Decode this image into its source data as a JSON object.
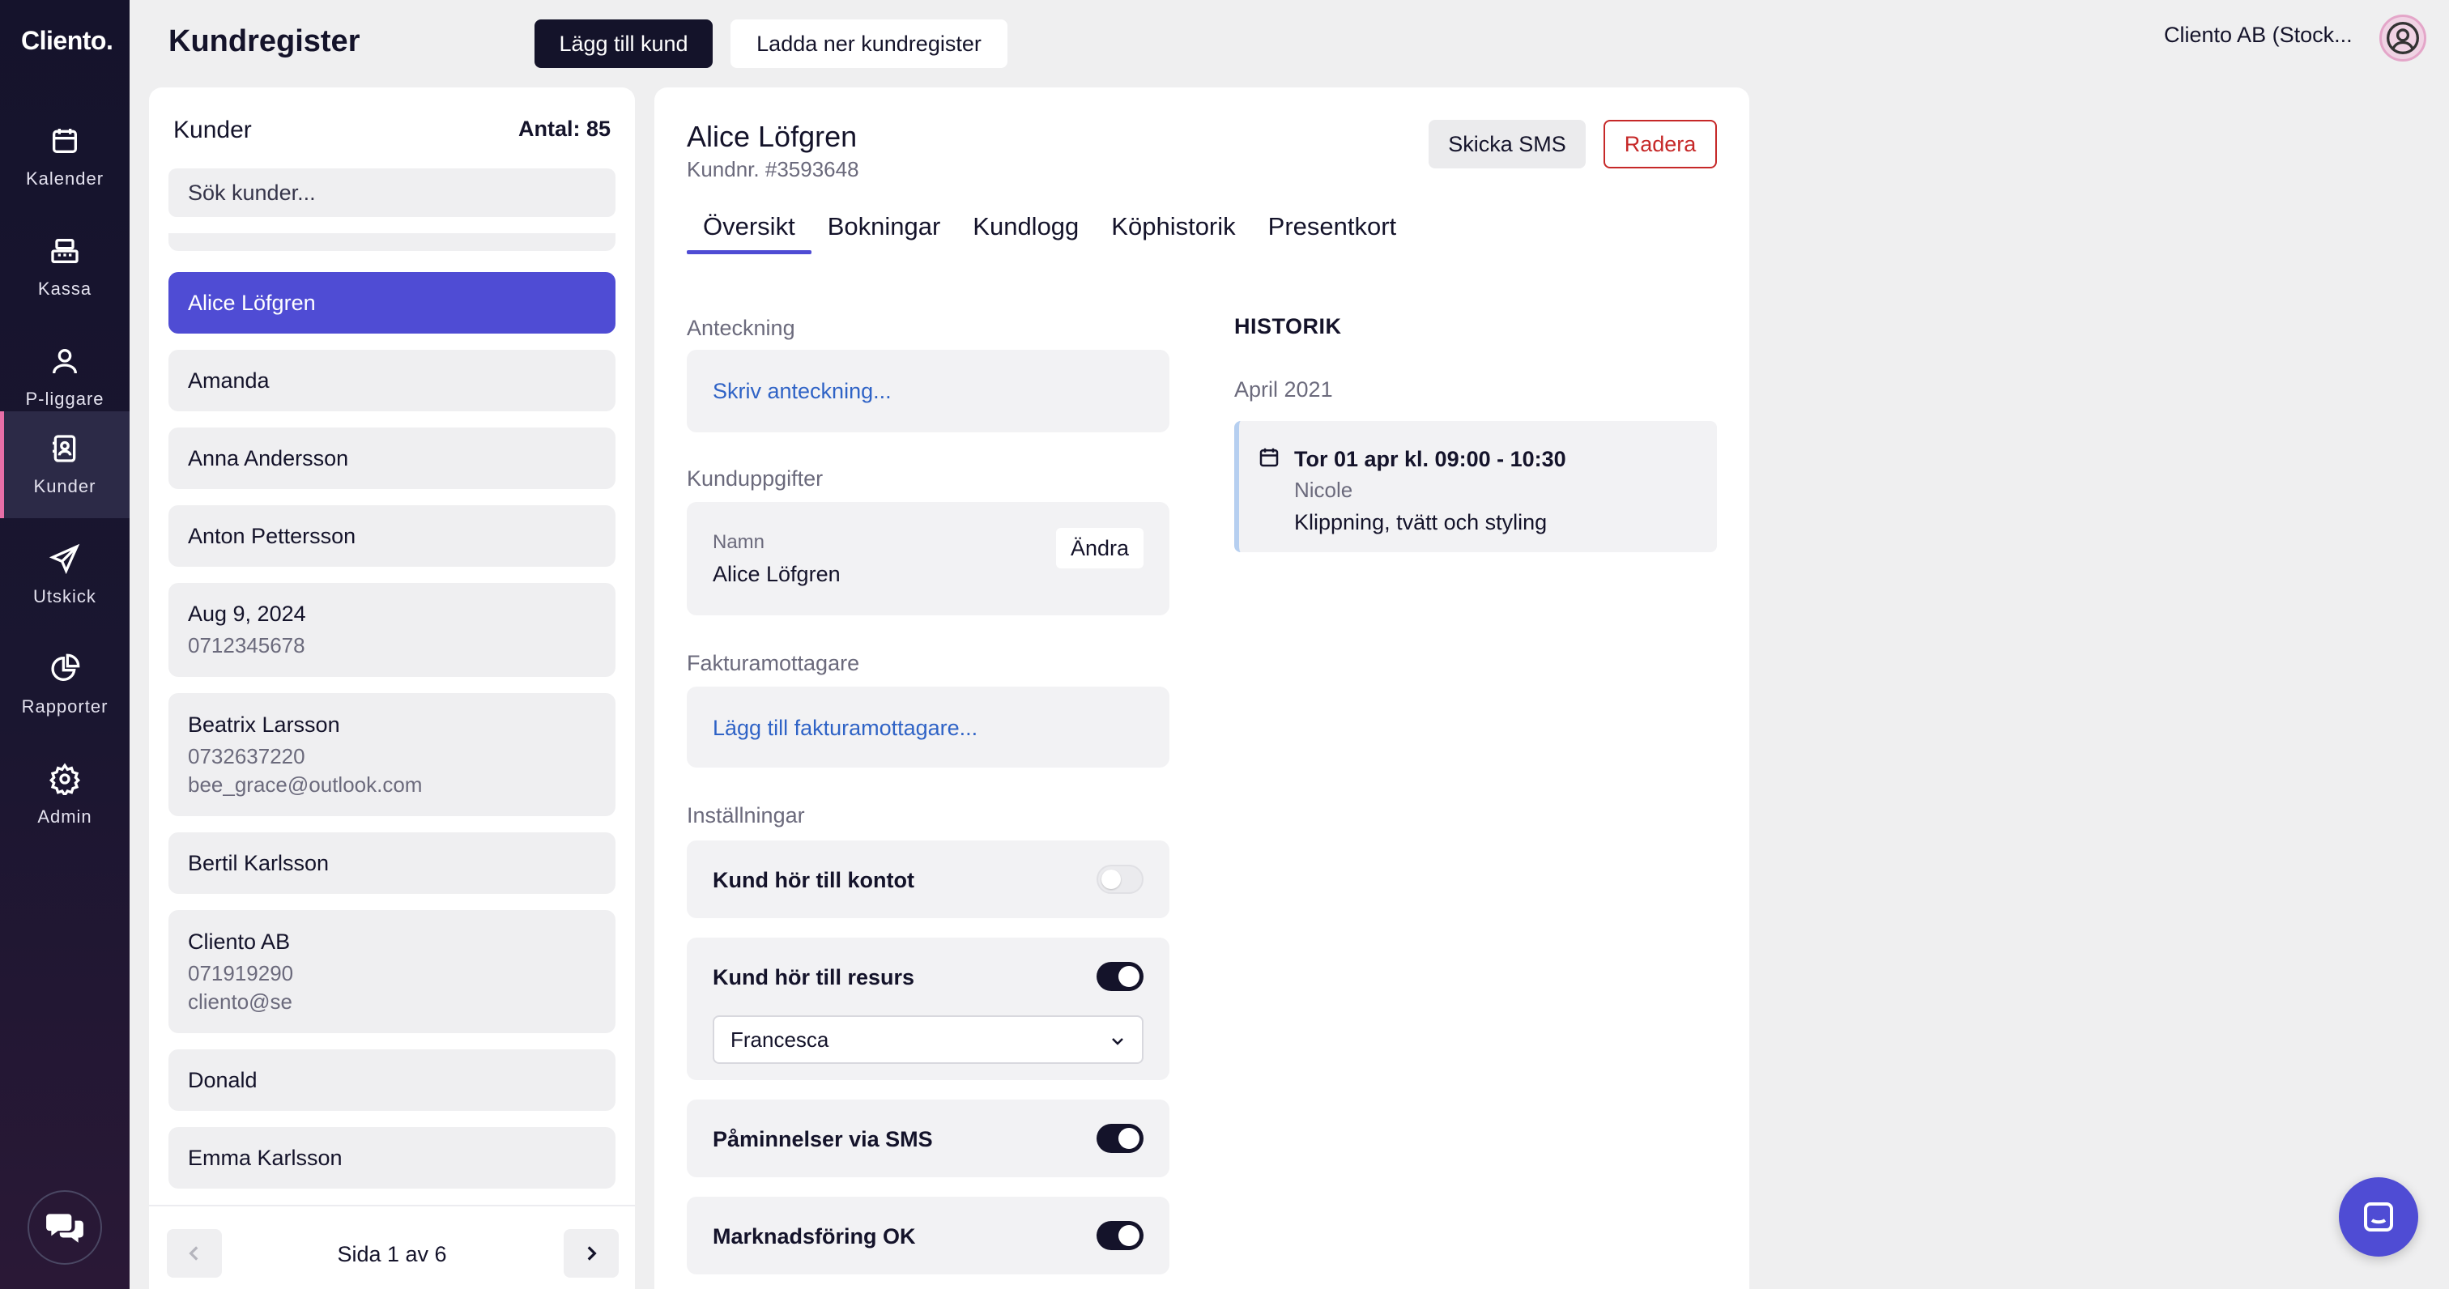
{
  "app": {
    "logo": "Cliento.",
    "page_title": "Kundregister"
  },
  "sidebar": {
    "items": [
      {
        "label": "Kalender",
        "icon": "calendar-icon"
      },
      {
        "label": "Kassa",
        "icon": "cash-register-icon"
      },
      {
        "label": "P-liggare",
        "icon": "person-icon"
      },
      {
        "label": "Kunder",
        "icon": "contacts-icon",
        "active": true
      },
      {
        "label": "Utskick",
        "icon": "send-icon"
      },
      {
        "label": "Rapporter",
        "icon": "pie-chart-icon"
      },
      {
        "label": "Admin",
        "icon": "gear-icon"
      }
    ],
    "help_icon": "chat-help-icon"
  },
  "toolbar": {
    "add_label": "Lägg till kund",
    "download_label": "Ladda ner kundregister",
    "account": "Cliento AB (Stock..."
  },
  "list": {
    "title": "Kunder",
    "count": "Antal: 85",
    "search_placeholder": "Sök kunder...",
    "items": [
      {
        "name": "Alice Löfgren",
        "active": true
      },
      {
        "name": "Amanda"
      },
      {
        "name": "Anna Andersson"
      },
      {
        "name": "Anton Pettersson"
      },
      {
        "name": "Aug 9, 2024",
        "phone": "0712345678"
      },
      {
        "name": "Beatrix Larsson",
        "phone": "0732637220",
        "email": "bee_grace@outlook.com"
      },
      {
        "name": "Bertil Karlsson"
      },
      {
        "name": "Cliento AB",
        "phone": "071919290",
        "email": "cliento@se"
      },
      {
        "name": "Donald"
      },
      {
        "name": "Emma Karlsson"
      }
    ],
    "pager": "Sida 1 av 6"
  },
  "customer": {
    "name": "Alice Löfgren",
    "number": "Kundnr. #3593648",
    "sms_label": "Skicka SMS",
    "delete_label": "Radera",
    "tabs": [
      "Översikt",
      "Bokningar",
      "Kundlogg",
      "Köphistorik",
      "Presentkort"
    ],
    "note": {
      "label": "Anteckning",
      "placeholder": "Skriv anteckning..."
    },
    "details": {
      "label": "Kunduppgifter",
      "field_label": "Namn",
      "field_value": "Alice Löfgren",
      "edit_label": "Ändra"
    },
    "invoice": {
      "label": "Fakturamottagare",
      "link": "Lägg till fakturamottagare..."
    },
    "settings": {
      "label": "Inställningar",
      "items": [
        {
          "label": "Kund hör till kontot",
          "on": false
        },
        {
          "label": "Kund hör till resurs",
          "on": true,
          "select": "Francesca"
        },
        {
          "label": "Påminnelser via SMS",
          "on": true
        },
        {
          "label": "Marknadsföring OK",
          "on": true
        }
      ]
    },
    "history": {
      "title": "HISTORIK",
      "month": "April 2021",
      "entries": [
        {
          "time": "Tor 01 apr kl. 09:00 - 10:30",
          "staff": "Nicole",
          "service": "Klippning, tvätt och styling"
        }
      ]
    }
  },
  "colors": {
    "accent": "#4f4cd4",
    "sidebar": "#15132c",
    "danger": "#c62828",
    "link": "#2f63c6"
  }
}
